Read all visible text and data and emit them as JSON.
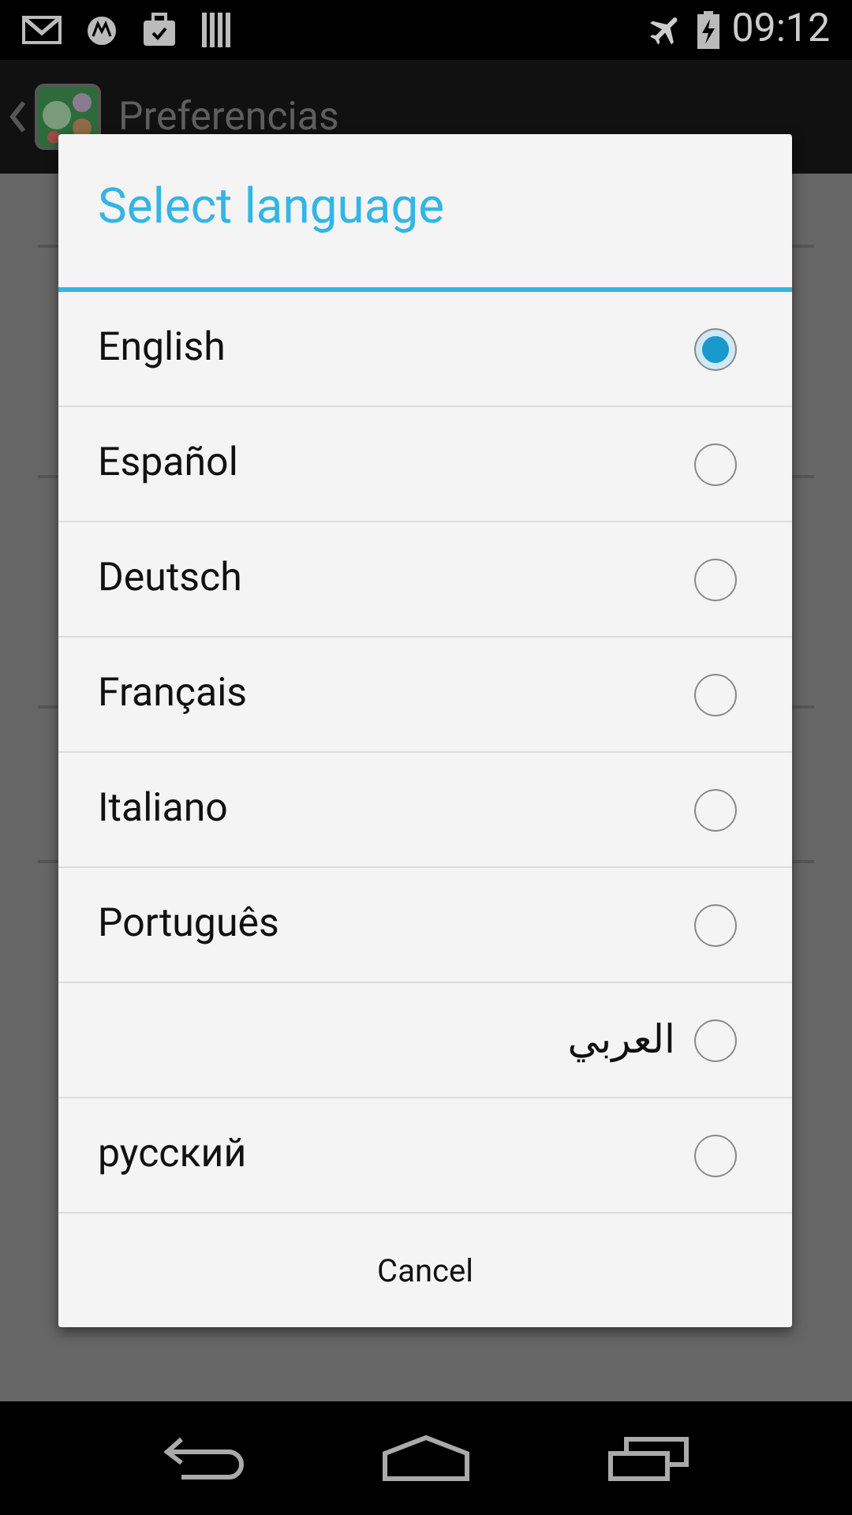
{
  "status_bar": {
    "time": "09:12"
  },
  "action_bar": {
    "title": "Preferencias"
  },
  "dialog": {
    "title": "Select language",
    "options": [
      {
        "label": "English",
        "selected": true,
        "kind": "ltr"
      },
      {
        "label": "Español",
        "selected": false,
        "kind": "ltr"
      },
      {
        "label": "Deutsch",
        "selected": false,
        "kind": "ltr"
      },
      {
        "label": "Français",
        "selected": false,
        "kind": "ltr"
      },
      {
        "label": "Italiano",
        "selected": false,
        "kind": "ltr"
      },
      {
        "label": "Português",
        "selected": false,
        "kind": "ltr"
      },
      {
        "label": "العربي",
        "selected": false,
        "kind": "rtl"
      },
      {
        "label": "русский",
        "selected": false,
        "kind": "ltr"
      }
    ],
    "cancel": "Cancel"
  }
}
